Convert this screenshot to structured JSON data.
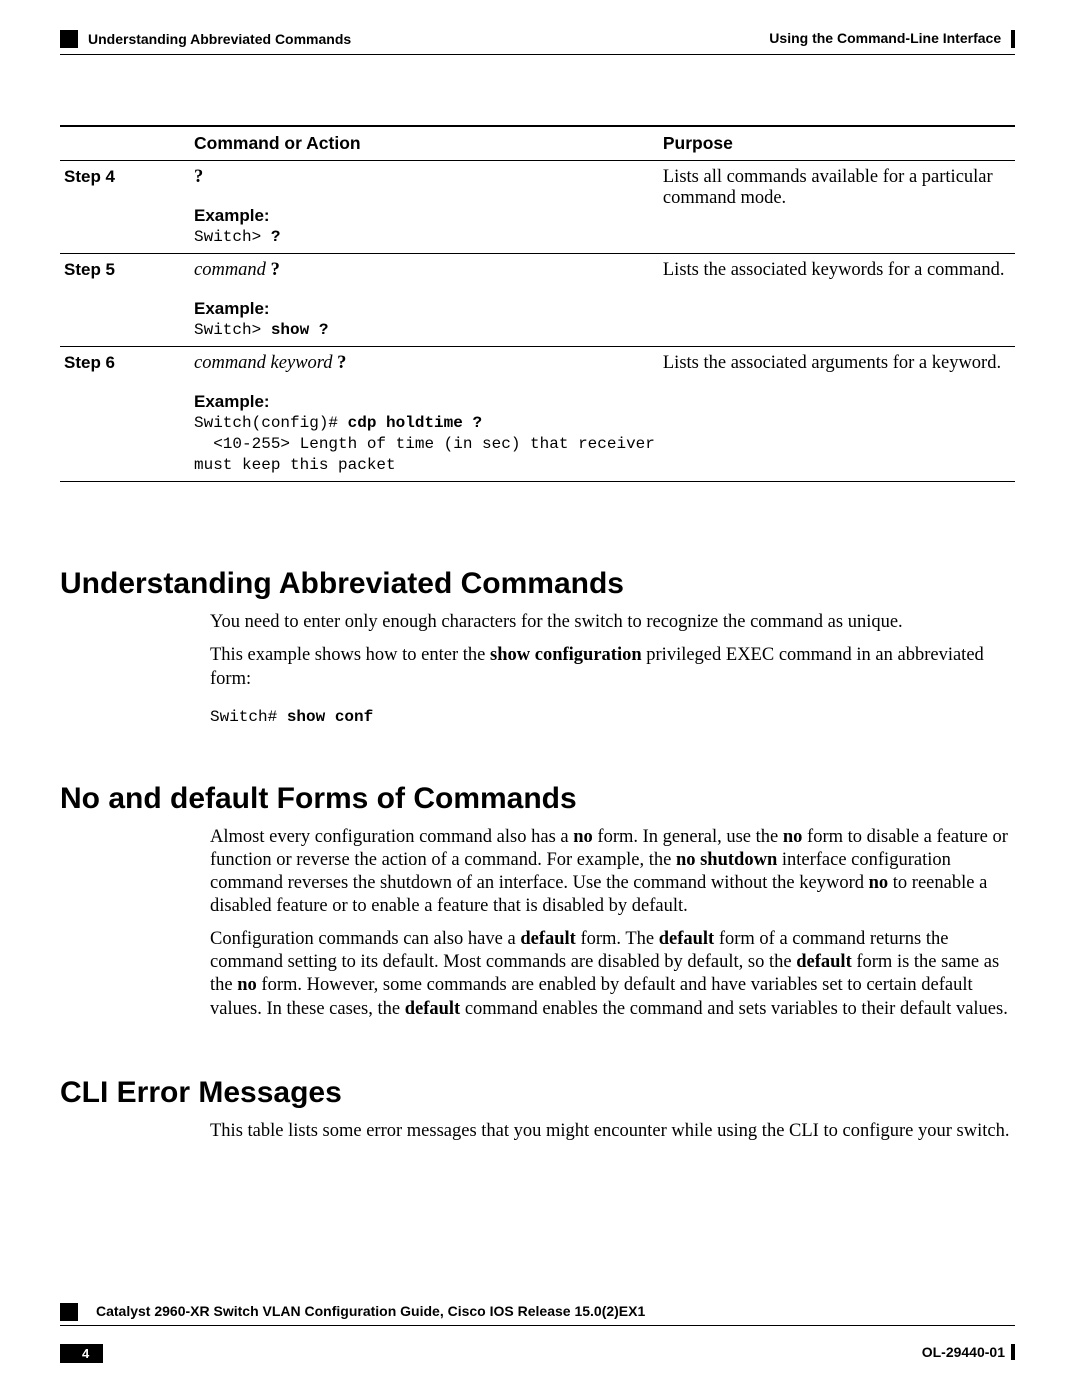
{
  "header": {
    "section_title": "Understanding Abbreviated Commands",
    "breadcrumb": "Using the Command-Line Interface"
  },
  "table": {
    "headers": {
      "step": "",
      "command": "Command or Action",
      "purpose": "Purpose"
    },
    "example_label": "Example:",
    "rows": [
      {
        "step": "Step 4",
        "command_plain": "?",
        "example_prefix": "Switch> ",
        "example_bold": "?",
        "example_suffix": "",
        "purpose": "Lists all commands available for a particular command mode."
      },
      {
        "step": "Step 5",
        "command_italic": "command",
        "command_bold_tail": " ?",
        "example_prefix": "Switch> ",
        "example_bold": "show ?",
        "example_suffix": "",
        "purpose": "Lists the associated keywords for a command."
      },
      {
        "step": "Step 6",
        "command_italic": "command keyword",
        "command_bold_tail": " ?",
        "example_prefix": "Switch(config)# ",
        "example_bold": "cdp holdtime ?",
        "example_suffix": "\n  <10-255> Length of time (in sec) that receiver\nmust keep this packet",
        "purpose": "Lists the associated arguments for a keyword."
      }
    ]
  },
  "sections": {
    "abbrev": {
      "heading": "Understanding Abbreviated Commands",
      "p1": "You need to enter only enough characters for the switch to recognize the command as unique.",
      "p2_pre": "This example shows how to enter the ",
      "p2_bold": "show configuration",
      "p2_post": " privileged EXEC command in an abbreviated form:",
      "code_prefix": "Switch# ",
      "code_bold": "show conf"
    },
    "no_default": {
      "heading": "No and default Forms of Commands",
      "p1": {
        "t1": "Almost every configuration command also has a ",
        "b1": "no",
        "t2": " form. In general, use the ",
        "b2": "no",
        "t3": " form to disable a feature or function or reverse the action of a command. For example, the ",
        "b3": "no shutdown",
        "t4": " interface configuration command reverses the shutdown of an interface. Use the command without the keyword ",
        "b4": "no",
        "t5": " to reenable a disabled feature or to enable a feature that is disabled by default."
      },
      "p2": {
        "t1": "Configuration commands can also have a ",
        "b1": "default",
        "t2": " form. The ",
        "b2": "default",
        "t3": " form of a command returns the command setting to its default. Most commands are disabled by default, so the ",
        "b3": "default",
        "t4": " form is the same as the ",
        "b4": "no",
        "t5": " form. However, some commands are enabled by default and have variables set to certain default values. In these cases, the ",
        "b5": "default",
        "t6": " command enables the command and sets variables to their default values."
      }
    },
    "cli_err": {
      "heading": "CLI Error Messages",
      "p1": "This table lists some error messages that you might encounter while using the CLI to configure your switch."
    }
  },
  "footer": {
    "guide_title": "Catalyst 2960-XR Switch VLAN Configuration Guide, Cisco IOS Release 15.0(2)EX1",
    "page_number": "4",
    "doc_id": "OL-29440-01"
  }
}
